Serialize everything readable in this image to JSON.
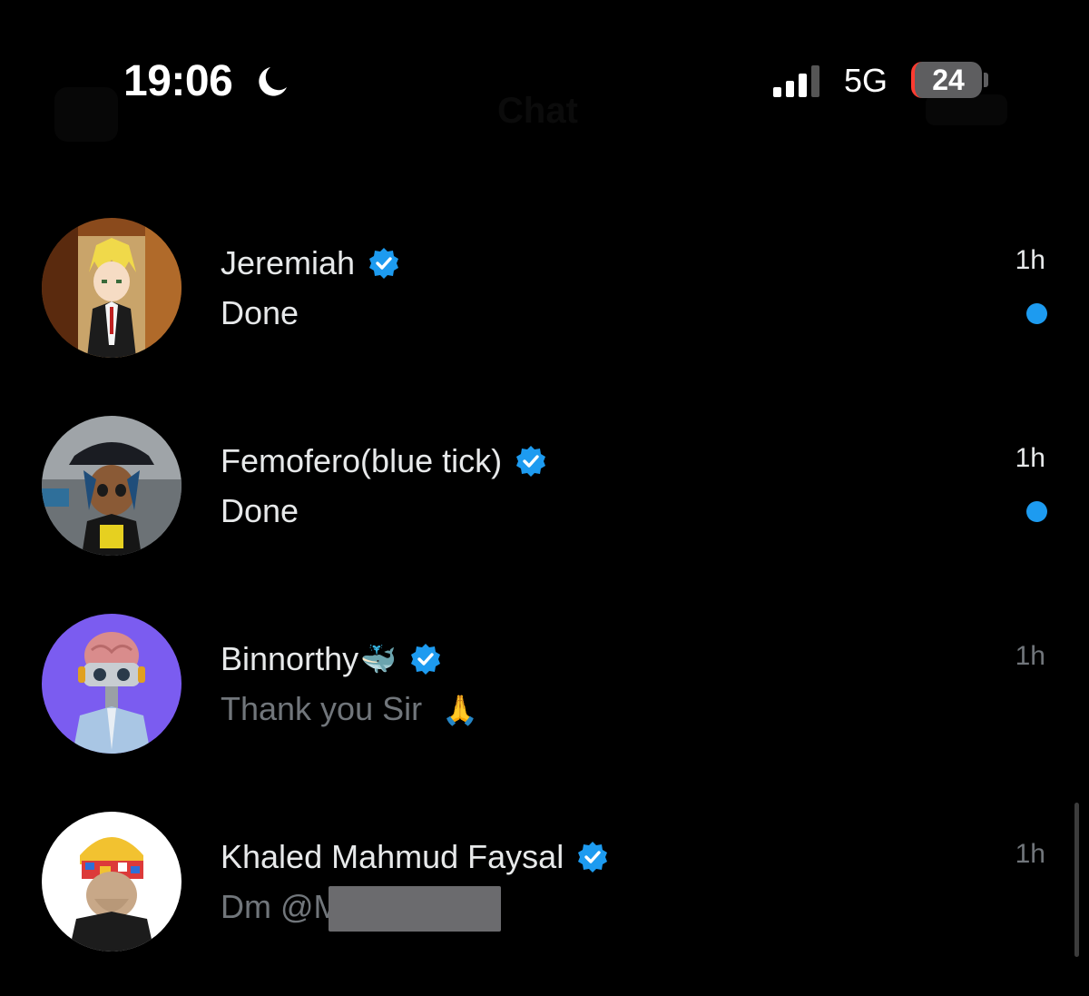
{
  "status_bar": {
    "time": "19:06",
    "network": "5G",
    "battery": "24"
  },
  "header": {
    "title": "Chat"
  },
  "colors": {
    "background": "#000000",
    "primary_text": "#e7e9ea",
    "secondary_text": "#71767b",
    "accent": "#1d9bf0",
    "battery_low": "#ff3b30"
  },
  "conversations": [
    {
      "name": "Jeremiah",
      "name_emoji": "",
      "verified": true,
      "preview": "Done",
      "preview_emoji": "",
      "time": "1h",
      "unread": true,
      "avatar_icon": "anime-blonde-character-avatar"
    },
    {
      "name": "Femofero(blue tick)",
      "name_emoji": "",
      "verified": true,
      "preview": "Done",
      "preview_emoji": "",
      "time": "1h",
      "unread": true,
      "avatar_icon": "cartoon-cap-character-avatar"
    },
    {
      "name": "Binnorthy",
      "name_emoji": "🐳",
      "verified": true,
      "preview": "Thank you Sir",
      "preview_emoji": "🙏",
      "time": "1h",
      "unread": false,
      "avatar_icon": "robot-brain-avatar"
    },
    {
      "name": "Khaled Mahmud Faysal",
      "name_emoji": "",
      "verified": true,
      "preview": "Dm @M on tg",
      "preview_emoji": "",
      "time": "1h",
      "unread": false,
      "avatar_icon": "ape-beanie-avatar"
    }
  ]
}
